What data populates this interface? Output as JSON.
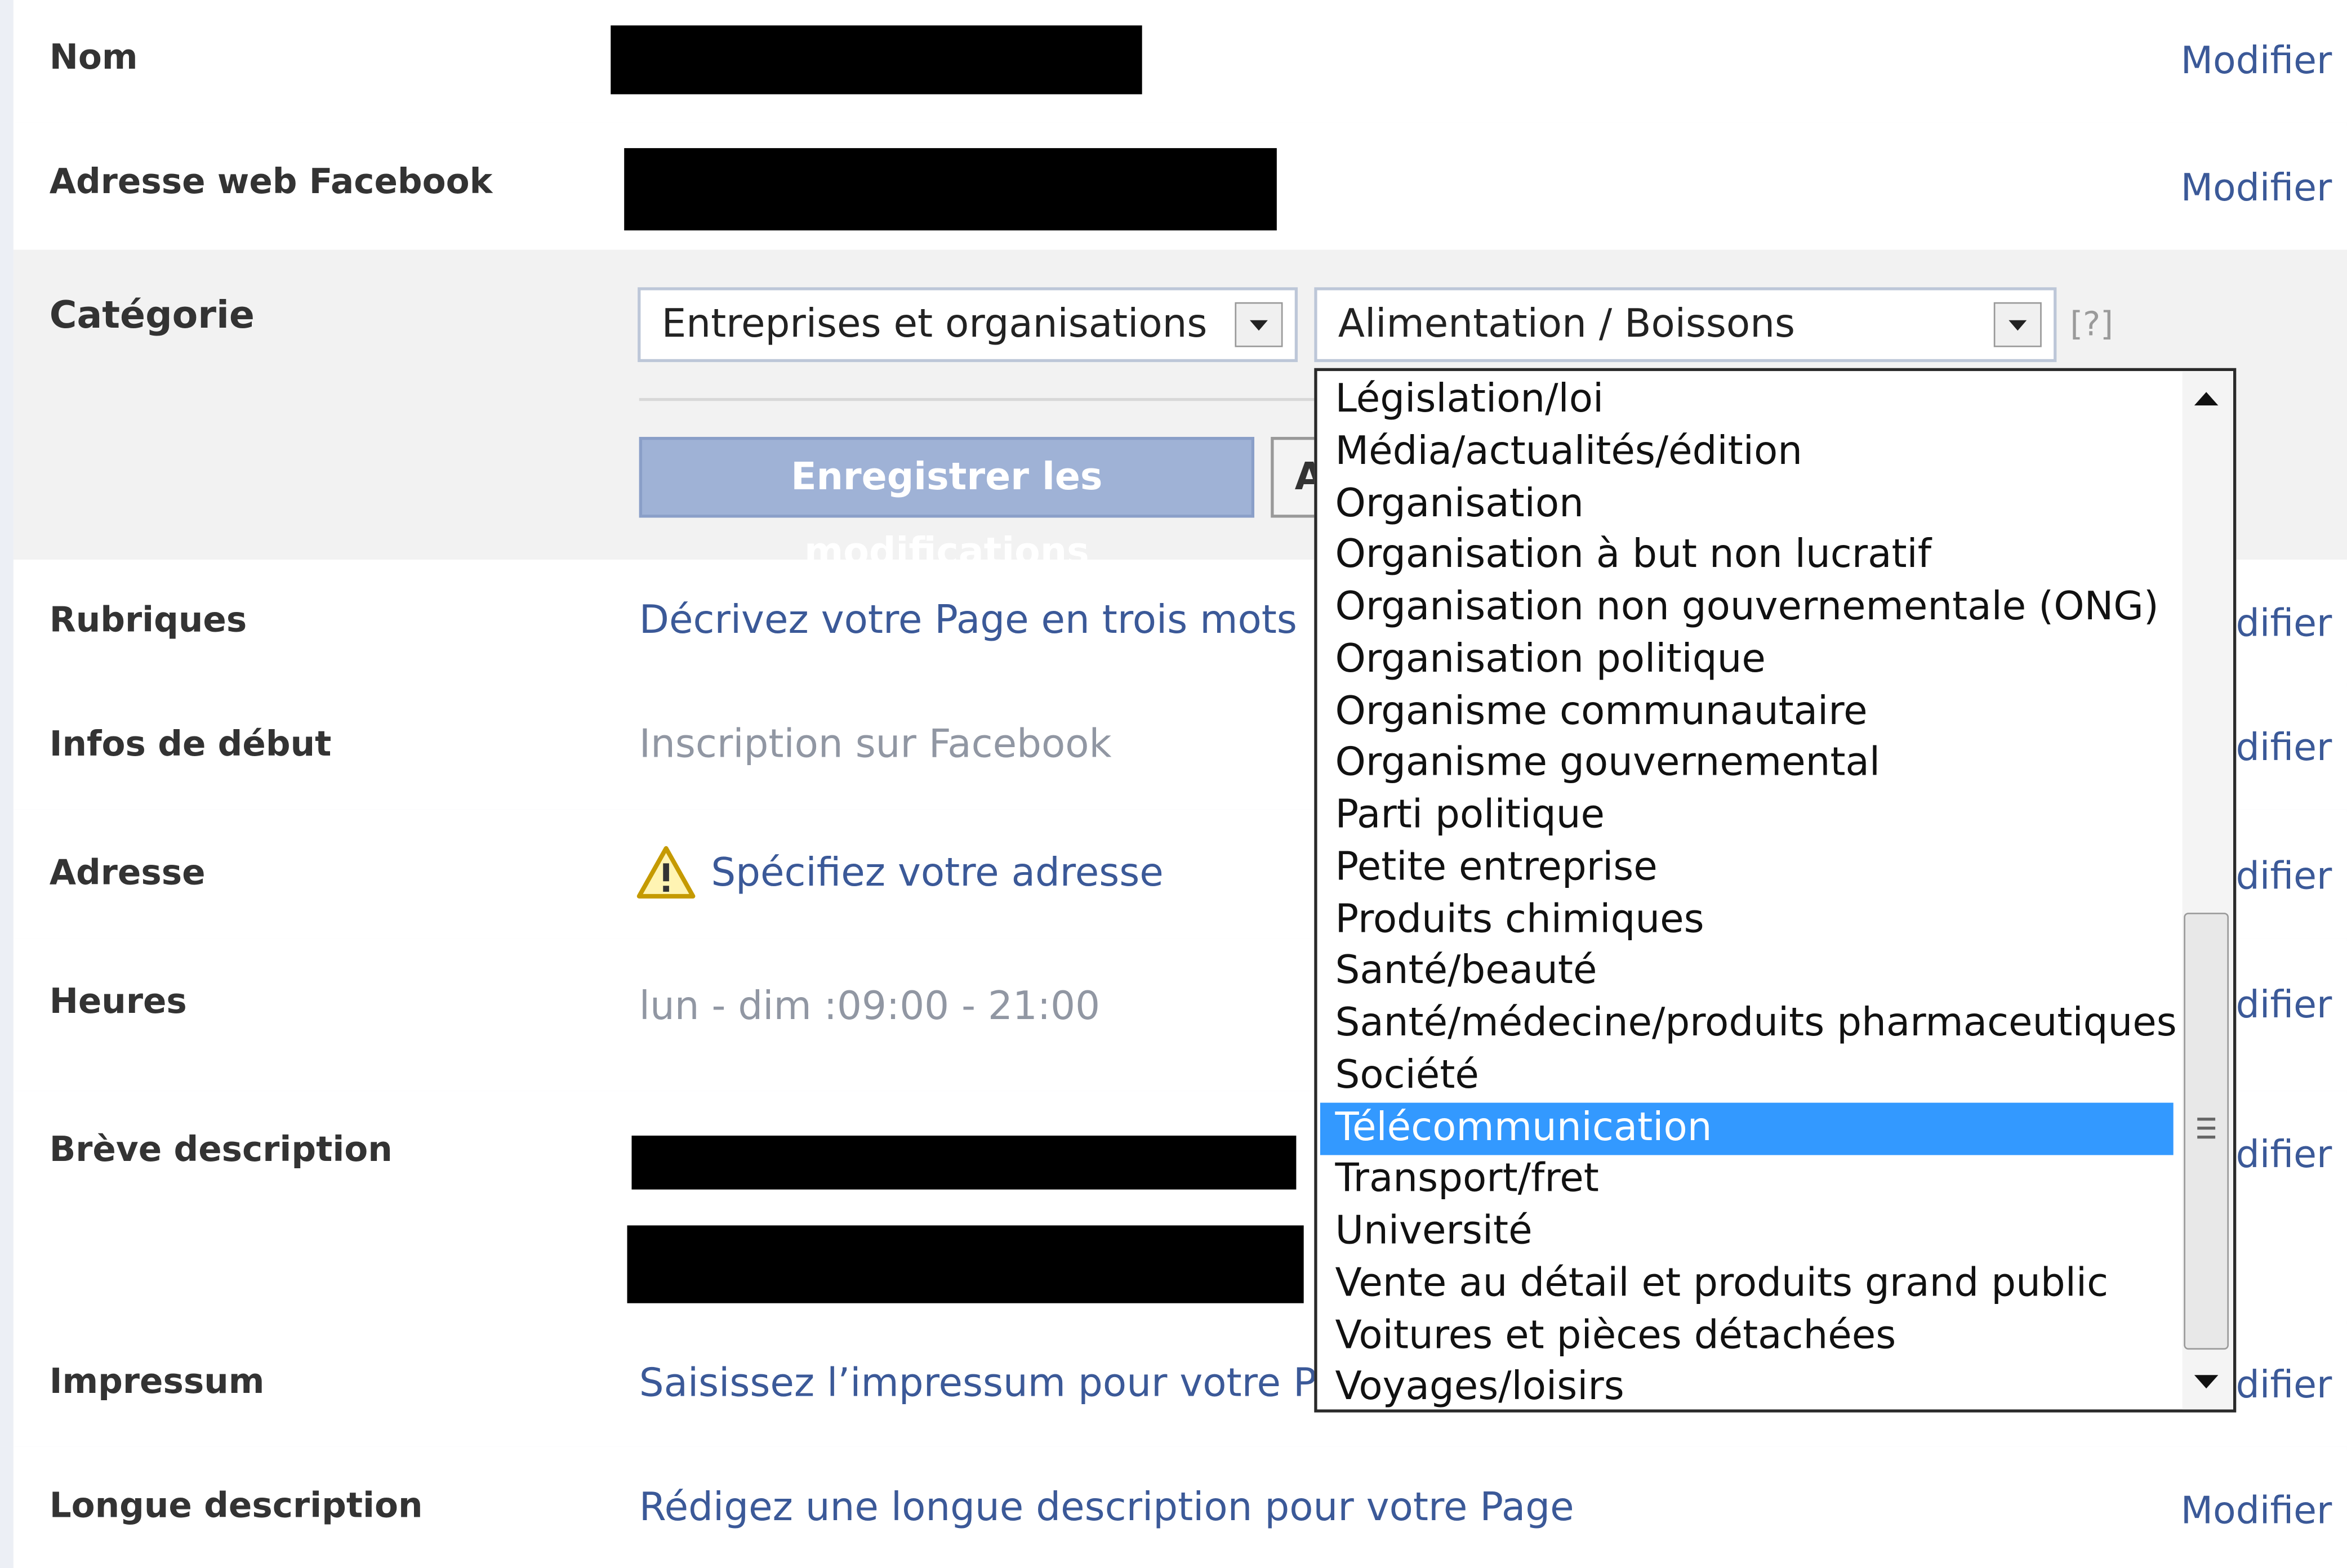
{
  "rows": {
    "nom": {
      "label": "Nom",
      "modifier": "Modifier"
    },
    "adresse_web": {
      "label": "Adresse web Facebook",
      "modifier": "Modifier"
    },
    "categorie": {
      "label": "Catégorie",
      "select1": "Entreprises et organisations",
      "select2": "Alimentation / Boissons",
      "help": "[?]",
      "save_button": "Enregistrer les modifications",
      "second_button_partial": "A"
    },
    "rubriques": {
      "label": "Rubriques",
      "value": "Décrivez votre Page en trois mots",
      "modifier": "difier"
    },
    "infos": {
      "label": "Infos de début",
      "value": "Inscription sur Facebook",
      "modifier": "difier"
    },
    "adresse": {
      "label": "Adresse",
      "value": "Spécifiez votre adresse",
      "modifier": "difier"
    },
    "heures": {
      "label": "Heures",
      "value": "lun - dim :09:00 - 21:00",
      "modifier": "difier"
    },
    "breve": {
      "label": "Brève description",
      "modifier": "difier"
    },
    "impressum": {
      "label": "Impressum",
      "value": "Saisissez l’impressum pour votre P",
      "modifier": "difier"
    },
    "longue": {
      "label": "Longue description",
      "value": "Rédigez une longue description pour votre Page",
      "modifier": "Modifier"
    }
  },
  "dropdown": {
    "options": [
      "Législation/loi",
      "Média/actualités/édition",
      "Organisation",
      "Organisation à but non lucratif",
      "Organisation non gouvernementale (ONG)",
      "Organisation politique",
      "Organisme communautaire",
      "Organisme gouvernemental",
      "Parti politique",
      "Petite entreprise",
      "Produits chimiques",
      "Santé/beauté",
      "Santé/médecine/produits pharmaceutiques",
      "Société",
      "Télécommunication",
      "Transport/fret",
      "Université",
      "Vente au détail et produits grand public",
      "Voitures et pièces détachées",
      "Voyages/loisirs"
    ],
    "selected": "Télécommunication"
  },
  "icons": {
    "warning": "warning-icon"
  },
  "colors": {
    "link": "#3b5998",
    "selection": "#3399ff",
    "save_button": "#9fb2d6"
  }
}
